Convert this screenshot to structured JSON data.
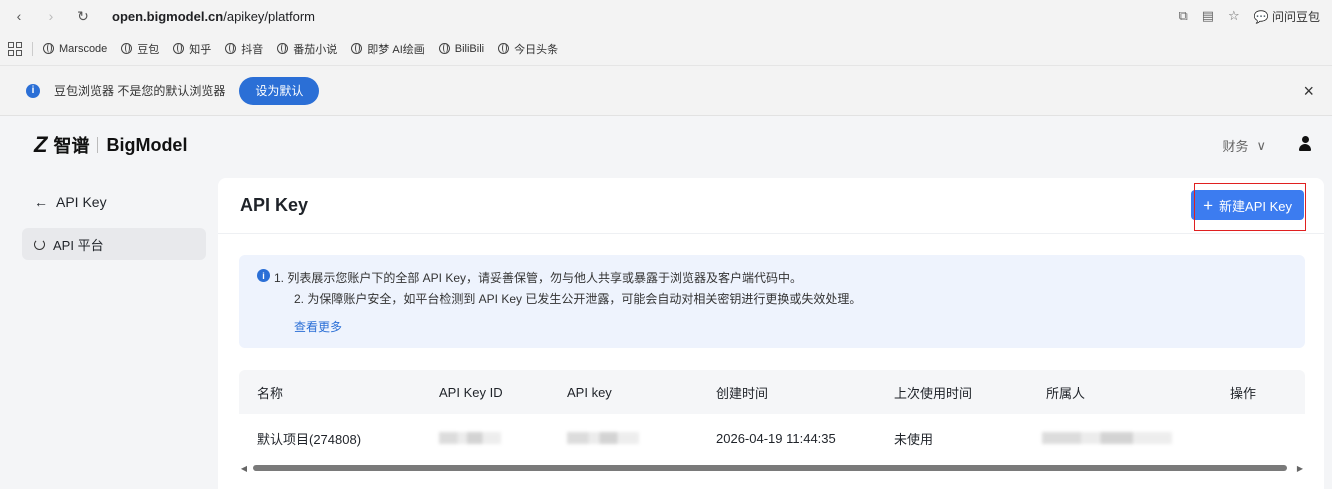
{
  "browser": {
    "url_host": "open.bigmodel.cn",
    "url_path": "/apikey/platform",
    "right_label": "问问豆包",
    "bookmarks": [
      "Marscode",
      "豆包",
      "知乎",
      "抖音",
      "番茄小说",
      "即梦 AI绘画",
      "BiliBili",
      "今日头条"
    ]
  },
  "notice": {
    "text": "豆包浏览器 不是您的默认浏览器",
    "button": "设为默认",
    "close": "×"
  },
  "header": {
    "logo_mark": "Z",
    "logo_cn": "智谱",
    "logo_en": "BigModel",
    "finance": "财务",
    "finance_chevron": "∨"
  },
  "sidebar": {
    "back_label": "API Key",
    "items": [
      {
        "label": "API 平台"
      }
    ]
  },
  "main": {
    "title": "API Key",
    "new_button": "新建API Key",
    "alert": {
      "line1": "1. 列表展示您账户下的全部 API Key，请妥善保管，勿与他人共享或暴露于浏览器及客户端代码中。",
      "line2": "2. 为保障账户安全，如平台检测到 API Key 已发生公开泄露，可能会自动对相关密钥进行更换或失效处理。",
      "link": "查看更多"
    },
    "table": {
      "columns": [
        "名称",
        "API Key ID",
        "API key",
        "创建时间",
        "上次使用时间",
        "所属人",
        "操作"
      ],
      "rows": [
        {
          "name": "默认项目(274808)",
          "created": "2026-04-19 11:44:35",
          "last_used": "未使用"
        }
      ]
    }
  },
  "colors": {
    "accent": "#3c7cf0",
    "highlight": "#e02020",
    "alert_bg": "#eef3fd"
  }
}
